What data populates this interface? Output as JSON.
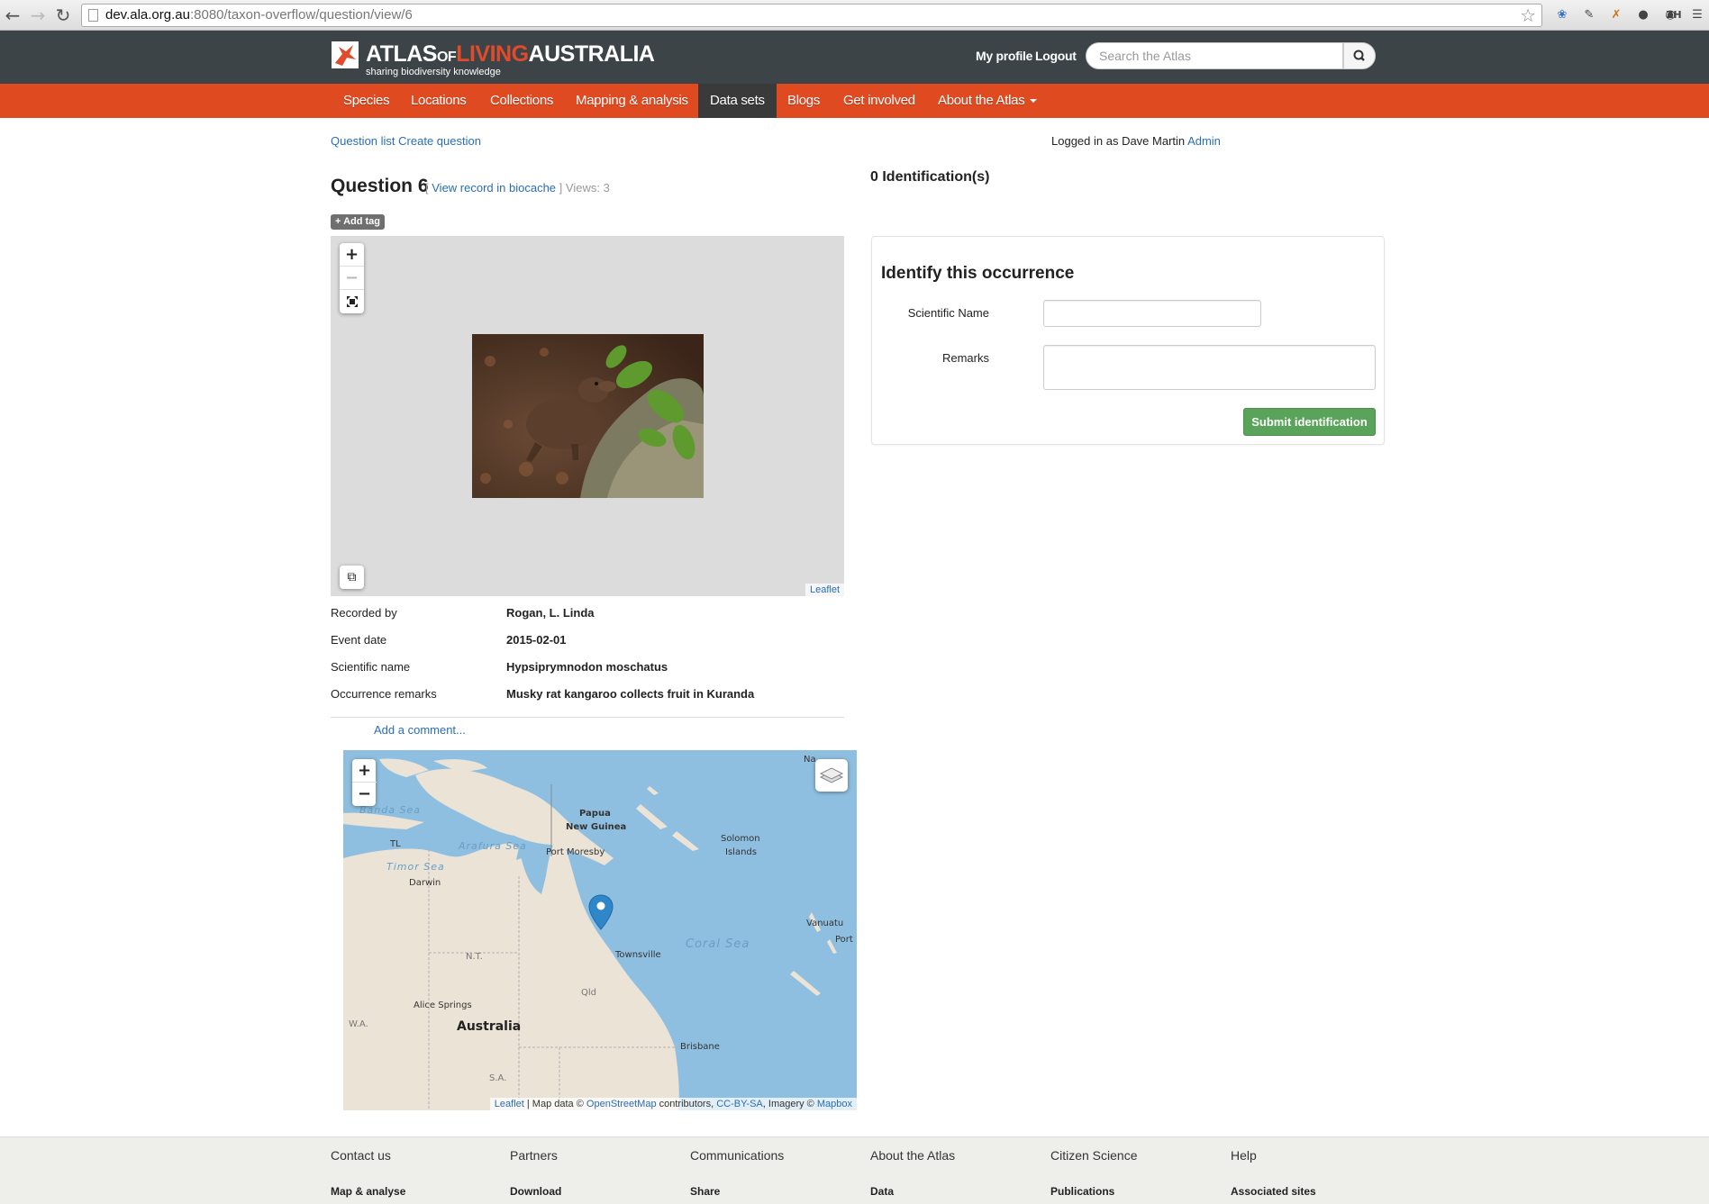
{
  "browser": {
    "url_host": "dev.ala.org.au",
    "url_path": ":8080/taxon-overflow/question/view/6",
    "extensions": [
      "ZH"
    ]
  },
  "header": {
    "logo": {
      "atlas": "ATLAS",
      "of": "OF",
      "living": "LIVING",
      "australia": "AUSTRALIA",
      "tagline": "sharing biodiversity knowledge"
    },
    "my_profile": "My profile",
    "logout": "Logout",
    "search_placeholder": "Search the Atlas"
  },
  "nav": {
    "items": [
      {
        "label": "Species"
      },
      {
        "label": "Locations"
      },
      {
        "label": "Collections"
      },
      {
        "label": "Mapping & analysis"
      },
      {
        "label": "Data sets",
        "active": true
      },
      {
        "label": "Blogs"
      },
      {
        "label": "Get involved"
      },
      {
        "label": "About the Atlas"
      }
    ]
  },
  "subnav": {
    "question_list": "Question list",
    "create_question": "Create question",
    "logged_in_text": "Logged in as Dave Martin",
    "admin": "Admin"
  },
  "question": {
    "title": "Question 6",
    "bracket_open": "[",
    "view_record": "View record in biocache",
    "bracket_close": "]",
    "views": "Views: 3",
    "add_tag": "+ Add tag",
    "image_attribution": "Leaflet"
  },
  "details": [
    {
      "label": "Recorded by",
      "value": "Rogan, L. Linda"
    },
    {
      "label": "Event date",
      "value": "2015-02-01"
    },
    {
      "label": "Scientific name",
      "value": "Hypsiprymnodon moschatus"
    },
    {
      "label": "Occurrence remarks",
      "value": "Musky rat kangaroo collects fruit in Kuranda"
    }
  ],
  "add_comment": "Add a comment...",
  "map": {
    "labels": {
      "banda": "Banda Sea",
      "arafura": "Arafura Sea",
      "timor": "Timor Sea",
      "tl": "TL",
      "png1": "Papua",
      "png2": "New Guinea",
      "moresby": "Port Moresby",
      "solomon1": "Solomon",
      "solomon2": "Islands",
      "darwin": "Darwin",
      "coral": "Coral Sea",
      "vanuatu": "Vanuatu",
      "port": "Port",
      "na": "Na",
      "townsville": "Townsville",
      "nt": "N.T.",
      "qld": "Qld",
      "alice": "Alice Springs",
      "australia": "Australia",
      "wa": "W.A.",
      "brisbane": "Brisbane",
      "sa": "S.A."
    },
    "attribution": {
      "leaflet": "Leaflet",
      "map_data": "| Map data ©",
      "osm": "OpenStreetMap",
      "contributors": "contributors,",
      "license": "CC-BY-SA",
      "imagery": ", Imagery ©",
      "mapbox": "Mapbox"
    }
  },
  "identification": {
    "count": "0 Identification(s)",
    "panel_title": "Identify this occurrence",
    "scientific_name_label": "Scientific Name",
    "remarks_label": "Remarks",
    "submit": "Submit identification"
  },
  "footer": {
    "columns": [
      {
        "head": "Contact us",
        "sub": "Map & analyse"
      },
      {
        "head": "Partners",
        "sub": "Download"
      },
      {
        "head": "Communications",
        "sub": "Share"
      },
      {
        "head": "About the Atlas",
        "sub": "Data"
      },
      {
        "head": "Citizen Science",
        "sub": "Publications"
      },
      {
        "head": "Help",
        "sub": "Associated sites"
      }
    ]
  },
  "colors": {
    "header_bg": "#3c4448",
    "nav_bg": "#df4a21",
    "link": "#2a6db5",
    "submit_bg": "#5aa35a"
  }
}
